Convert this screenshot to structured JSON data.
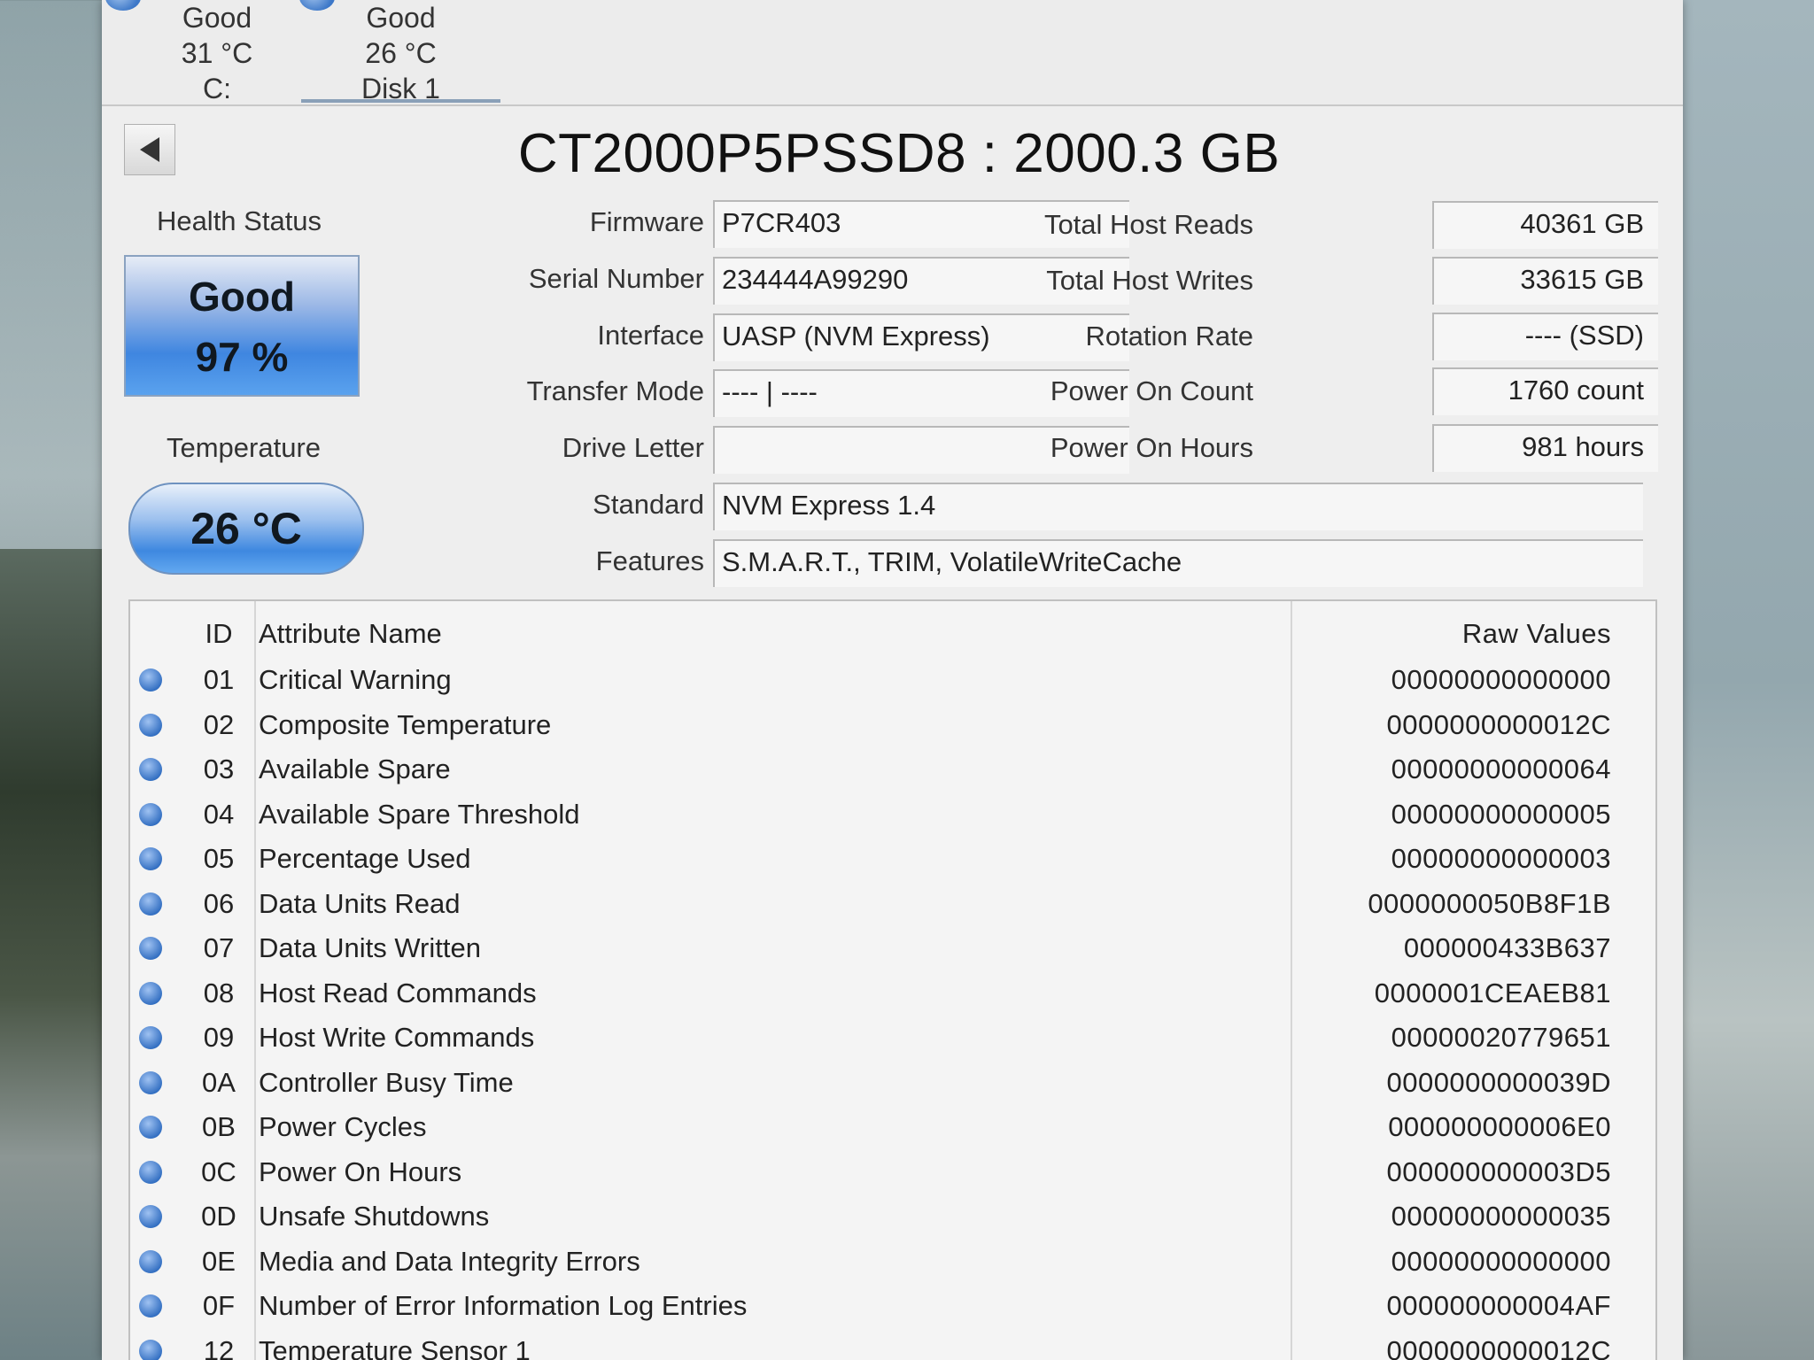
{
  "disk_tabs": [
    {
      "status": "Good",
      "temp": "31 °C",
      "label": "C:"
    },
    {
      "status": "Good",
      "temp": "26 °C",
      "label": "Disk 1"
    }
  ],
  "title": "CT2000P5PSSD8 : 2000.3 GB",
  "health": {
    "label": "Health Status",
    "status": "Good",
    "percent": "97 %"
  },
  "temperature": {
    "label": "Temperature",
    "value": "26 °C"
  },
  "fields": {
    "firmware": {
      "label": "Firmware",
      "value": "P7CR403"
    },
    "serial": {
      "label": "Serial Number",
      "value": "234444A99290"
    },
    "interface": {
      "label": "Interface",
      "value": "UASP (NVM Express)"
    },
    "transfer_mode": {
      "label": "Transfer Mode",
      "value": "---- | ----"
    },
    "drive_letter": {
      "label": "Drive Letter",
      "value": ""
    },
    "standard": {
      "label": "Standard",
      "value": "NVM Express 1.4"
    },
    "features": {
      "label": "Features",
      "value": "S.M.A.R.T., TRIM, VolatileWriteCache"
    },
    "total_host_reads": {
      "label": "Total Host Reads",
      "value": "40361 GB"
    },
    "total_host_writes": {
      "label": "Total Host Writes",
      "value": "33615 GB"
    },
    "rotation_rate": {
      "label": "Rotation Rate",
      "value": "---- (SSD)"
    },
    "power_on_count": {
      "label": "Power On Count",
      "value": "1760 count"
    },
    "power_on_hours": {
      "label": "Power On Hours",
      "value": "981 hours"
    }
  },
  "smart": {
    "headers": {
      "id": "ID",
      "name": "Attribute Name",
      "raw": "Raw Values"
    },
    "rows": [
      {
        "id": "01",
        "name": "Critical Warning",
        "raw": "00000000000000"
      },
      {
        "id": "02",
        "name": "Composite Temperature",
        "raw": "0000000000012C"
      },
      {
        "id": "03",
        "name": "Available Spare",
        "raw": "00000000000064"
      },
      {
        "id": "04",
        "name": "Available Spare Threshold",
        "raw": "00000000000005"
      },
      {
        "id": "05",
        "name": "Percentage Used",
        "raw": "00000000000003"
      },
      {
        "id": "06",
        "name": "Data Units Read",
        "raw": "0000000050B8F1B"
      },
      {
        "id": "07",
        "name": "Data Units Written",
        "raw": "000000433B637"
      },
      {
        "id": "08",
        "name": "Host Read Commands",
        "raw": "0000001CEAEB81"
      },
      {
        "id": "09",
        "name": "Host Write Commands",
        "raw": "00000020779651"
      },
      {
        "id": "0A",
        "name": "Controller Busy Time",
        "raw": "0000000000039D"
      },
      {
        "id": "0B",
        "name": "Power Cycles",
        "raw": "000000000006E0"
      },
      {
        "id": "0C",
        "name": "Power On Hours",
        "raw": "000000000003D5"
      },
      {
        "id": "0D",
        "name": "Unsafe Shutdowns",
        "raw": "00000000000035"
      },
      {
        "id": "0E",
        "name": "Media and Data Integrity Errors",
        "raw": "00000000000000"
      },
      {
        "id": "0F",
        "name": "Number of Error Information Log Entries",
        "raw": "000000000004AF"
      },
      {
        "id": "12",
        "name": "Temperature Sensor 1",
        "raw": "0000000000012C"
      }
    ]
  }
}
